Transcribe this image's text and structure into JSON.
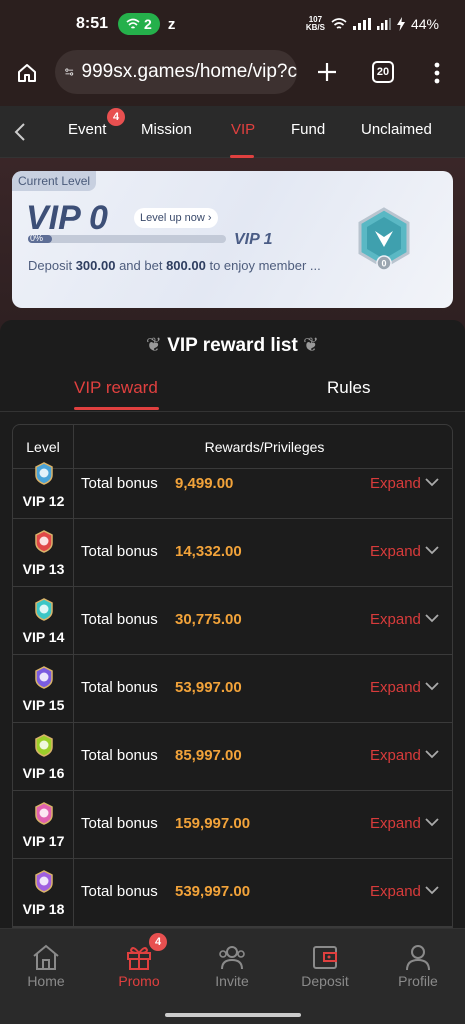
{
  "status_bar": {
    "time": "8:51",
    "call_count": "2",
    "net_speed_value": "107",
    "net_speed_unit": "KB/S",
    "battery": "44%"
  },
  "browser": {
    "url": "999sx.games/home/vip?c",
    "tab_count": "20"
  },
  "nav_tabs": [
    {
      "label": "Event",
      "badge": "4"
    },
    {
      "label": "Mission"
    },
    {
      "label": "VIP",
      "active": true
    },
    {
      "label": "Fund"
    },
    {
      "label": "Unclaimed"
    }
  ],
  "level_card": {
    "tag": "Current Level",
    "current_vip": "VIP 0",
    "level_up": "Level up now",
    "progress_label": "0%",
    "progress": 0,
    "next_vip": "VIP 1",
    "deposit_prefix": "Deposit ",
    "deposit_amount": "300.00",
    "bet_text": " and bet ",
    "bet_amount": "800.00",
    "deposit_suffix": " to enjoy member ...",
    "emblem_level": "0"
  },
  "reward_list": {
    "title": "VIP reward list",
    "tabs": [
      "VIP reward",
      "Rules"
    ],
    "headers": [
      "Level",
      "Rewards/Privileges"
    ],
    "bonus_label": "Total bonus",
    "expand_label": "Expand",
    "rows": [
      {
        "level": "VIP 12",
        "amount": "9,499.00",
        "color": "#4aa3d8"
      },
      {
        "level": "VIP 13",
        "amount": "14,332.00",
        "color": "#e04848"
      },
      {
        "level": "VIP 14",
        "amount": "30,775.00",
        "color": "#3cc6c6"
      },
      {
        "level": "VIP 15",
        "amount": "53,997.00",
        "color": "#7a5ce0"
      },
      {
        "level": "VIP 16",
        "amount": "85,997.00",
        "color": "#9ccf2a"
      },
      {
        "level": "VIP 17",
        "amount": "159,997.00",
        "color": "#e060b0"
      },
      {
        "level": "VIP 18",
        "amount": "539,997.00",
        "color": "#a060e0"
      }
    ]
  },
  "bottom_nav": [
    {
      "label": "Home"
    },
    {
      "label": "Promo",
      "badge": "4",
      "active": true
    },
    {
      "label": "Invite"
    },
    {
      "label": "Deposit"
    },
    {
      "label": "Profile"
    }
  ],
  "colors": {
    "accent": "#e0403f",
    "amount": "#f2a33a",
    "expand": "#d83b3b"
  }
}
